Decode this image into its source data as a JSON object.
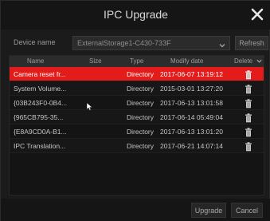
{
  "dialog": {
    "title": "IPC Upgrade",
    "close_icon": "close-icon"
  },
  "device": {
    "label": "Device name",
    "selected": "ExternalStorage1-C430-733F",
    "refresh_label": "Refresh"
  },
  "table": {
    "headers": {
      "name": "Name",
      "size": "Size",
      "type": "Type",
      "date": "Modify date",
      "delete": "Delete"
    },
    "rows": [
      {
        "name": "Camera reset fr...",
        "size": "",
        "type": "Directory",
        "date": "2017-06-07 13:19:12",
        "selected": true
      },
      {
        "name": "System Volume...",
        "size": "",
        "type": "Directory",
        "date": "2015-03-01 13:27:20",
        "selected": false
      },
      {
        "name": "{03B243F0-0B4...",
        "size": "",
        "type": "Directory",
        "date": "2017-06-13 13:01:58",
        "selected": false
      },
      {
        "name": "{965CB795-35...",
        "size": "",
        "type": "Directory",
        "date": "2017-06-14 05:49:04",
        "selected": false
      },
      {
        "name": "{E8A9CD0A-B1...",
        "size": "",
        "type": "Directory",
        "date": "2017-06-13 13:01:20",
        "selected": false
      },
      {
        "name": "IPC Translation...",
        "size": "",
        "type": "Directory",
        "date": "2017-06-21 14:07:14",
        "selected": false
      }
    ]
  },
  "footer": {
    "upgrade_label": "Upgrade",
    "cancel_label": "Cancel"
  },
  "colors": {
    "selected_row": "#e41b1b",
    "background": "#1b1b1b",
    "header": "#2c2c2c"
  }
}
